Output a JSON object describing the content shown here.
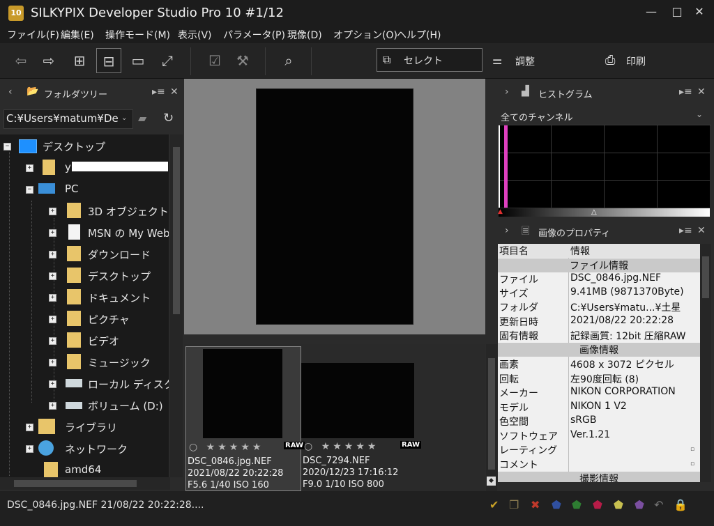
{
  "window": {
    "logo": "10",
    "title": "SILKYPIX Developer Studio Pro 10   #1/12",
    "minimize": "—",
    "maximize": "□",
    "close": "✕"
  },
  "menu": [
    "ファイル(F)",
    "編集(E)",
    "操作モード(M)",
    "表示(V)",
    "パラメータ(P)",
    "現像(D)",
    "オプション(O)",
    "ヘルプ(H)"
  ],
  "modes": {
    "select": "セレクト",
    "adjust": "調整",
    "print": "印刷"
  },
  "folder_tree": {
    "title": "フォルダツリー",
    "path": "C:¥Users¥matum¥De",
    "items": [
      {
        "label": "デスクトップ",
        "expander": "−"
      },
      {
        "label": "y",
        "expander": "+"
      },
      {
        "label": "PC",
        "expander": "−"
      },
      {
        "label": "3D オブジェクト",
        "expander": "+"
      },
      {
        "label": "MSN の My Web",
        "expander": "+"
      },
      {
        "label": "ダウンロード",
        "expander": "+"
      },
      {
        "label": "デスクトップ",
        "expander": "+"
      },
      {
        "label": "ドキュメント",
        "expander": "+"
      },
      {
        "label": "ピクチャ",
        "expander": "+"
      },
      {
        "label": "ビデオ",
        "expander": "+"
      },
      {
        "label": "ミュージック",
        "expander": "+"
      },
      {
        "label": "ローカル ディスク (C",
        "expander": "+"
      },
      {
        "label": "ボリューム (D:)",
        "expander": "+"
      },
      {
        "label": "ライブラリ",
        "expander": "+"
      },
      {
        "label": "ネットワーク",
        "expander": "+"
      },
      {
        "label": "amd64",
        "expander": ""
      }
    ]
  },
  "thumbnails": [
    {
      "stars": "○ ★★★★★",
      "raw": "RAW",
      "name": "DSC_0846.jpg.NEF",
      "date": "2021/08/22 20:22:28",
      "exposure": "F5.6 1/40 ISO 160"
    },
    {
      "stars": "○ ★★★★★",
      "raw": "RAW",
      "name": "DSC_7294.NEF",
      "date": "2020/12/23 17:16:12",
      "exposure": "F9.0 1/10 ISO 800"
    }
  ],
  "histogram": {
    "title": "ヒストグラム",
    "channel": "全てのチャンネル"
  },
  "properties": {
    "title": "画像のプロパティ",
    "header_key": "項目名",
    "header_value": "情報",
    "section_file": "ファイル情報",
    "file_rows": [
      {
        "k": "ファイル",
        "v": "DSC_0846.jpg.NEF"
      },
      {
        "k": "サイズ",
        "v": "9.41MB (9871370Byte)"
      },
      {
        "k": "フォルダ",
        "v": "C:¥Users¥matu...¥土星"
      },
      {
        "k": "更新日時",
        "v": "2021/08/22 20:22:28"
      },
      {
        "k": "固有情報",
        "v": "記録画質: 12bit 圧縮RAW"
      }
    ],
    "section_image": "画像情報",
    "image_rows": [
      {
        "k": "画素",
        "v": "4608 x 3072 ピクセル"
      },
      {
        "k": "回転",
        "v": "左90度回転 (8)"
      },
      {
        "k": "メーカー",
        "v": "NIKON CORPORATION"
      },
      {
        "k": "モデル",
        "v": "NIKON 1 V2"
      },
      {
        "k": "色空間",
        "v": "sRGB"
      },
      {
        "k": "ソフトウェア",
        "v": "Ver.1.21"
      },
      {
        "k": "レーティング",
        "v": ""
      },
      {
        "k": "コメント",
        "v": ""
      }
    ],
    "section_shooting": "撮影情報"
  },
  "status": {
    "text": "DSC_0846.jpg.NEF 21/08/22 20:22:28...."
  },
  "colors": {
    "accent_check": "#c9a227",
    "reject": "#c0392b",
    "magenta": "#e040c0"
  }
}
